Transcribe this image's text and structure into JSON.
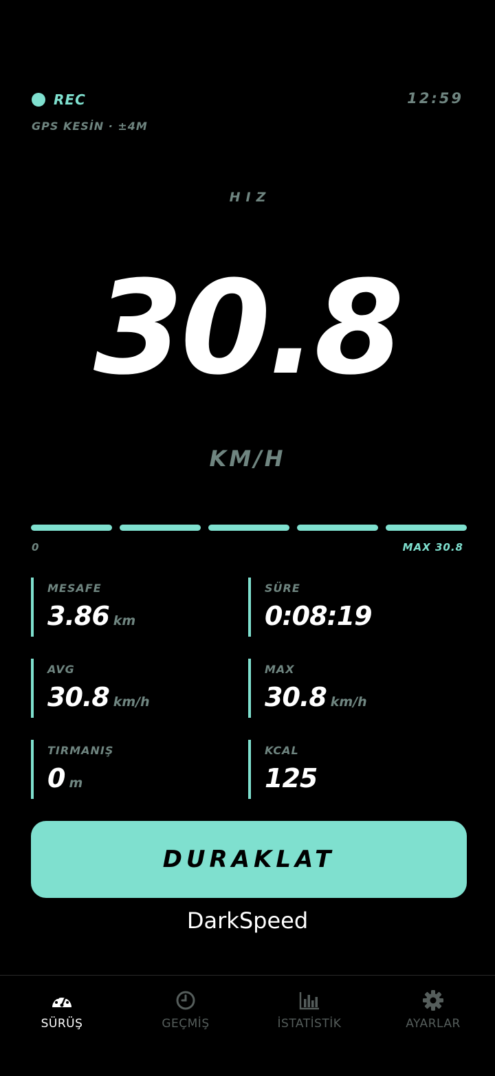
{
  "status": {
    "rec_label": "REC",
    "clock": "12:59",
    "gps": "GPS KESİN · ±4M"
  },
  "speed": {
    "caption": "HIZ",
    "value": "30.8",
    "unit": "KM/H"
  },
  "speed_bar": {
    "min_label": "0",
    "max_label": "MAX 30.8",
    "segments_filled": 5,
    "segments_total": 5,
    "color": "#7fe0cf"
  },
  "stats": {
    "distance": {
      "label": "MESAFE",
      "value": "3.86",
      "unit": "km"
    },
    "duration": {
      "label": "SÜRE",
      "value": "0:08:19",
      "unit": ""
    },
    "avg": {
      "label": "AVG",
      "value": "30.8",
      "unit": "km/h"
    },
    "max": {
      "label": "MAX",
      "value": "30.8",
      "unit": "km/h"
    },
    "climb": {
      "label": "TIRMANIŞ",
      "value": "0",
      "unit": "m"
    },
    "kcal": {
      "label": "KCAL",
      "value": "125",
      "unit": ""
    }
  },
  "pause_button": {
    "label": "DURAKLAT"
  },
  "app_name": "DarkSpeed",
  "nav": {
    "items": [
      {
        "label": "SÜRÜŞ",
        "icon": "speedometer-icon",
        "active": true
      },
      {
        "label": "GEÇMİŞ",
        "icon": "clock-icon",
        "active": false
      },
      {
        "label": "İSTATİSTİK",
        "icon": "bar-chart-icon",
        "active": false
      },
      {
        "label": "AYARLAR",
        "icon": "gear-icon",
        "active": false
      }
    ]
  },
  "colors": {
    "accent": "#7fe0cf",
    "muted": "#6f8580",
    "background": "#000000",
    "nav_inactive": "#555d5b"
  }
}
